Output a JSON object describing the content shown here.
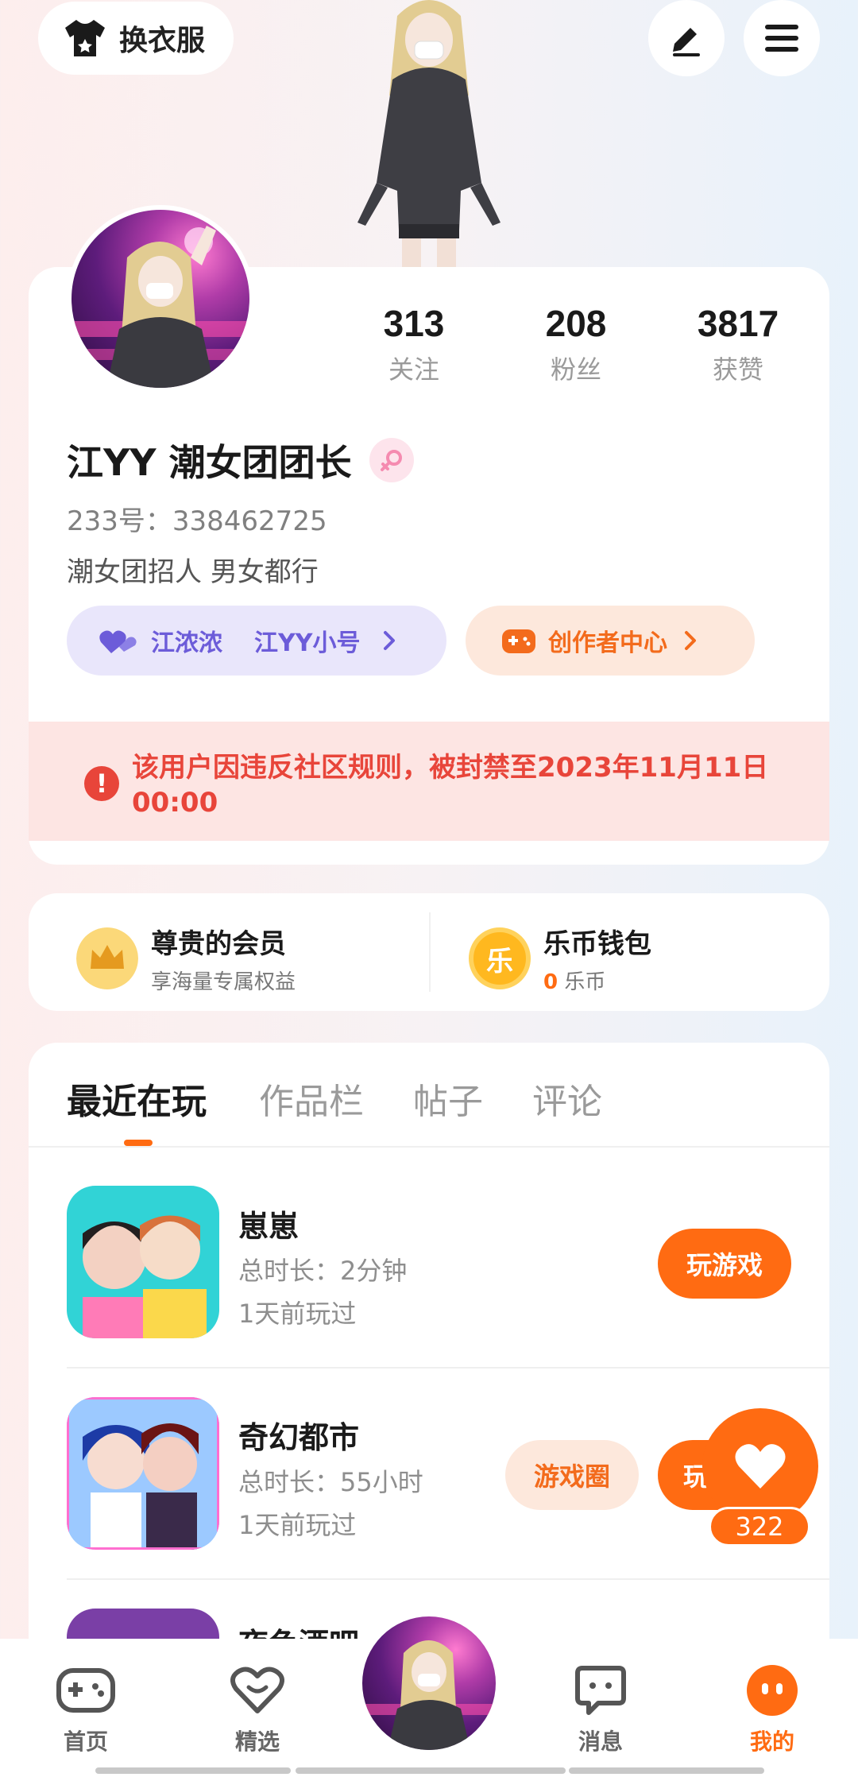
{
  "top_bar": {
    "outfit_label": "换衣服"
  },
  "profile": {
    "stats": [
      {
        "value": "313",
        "label": "关注"
      },
      {
        "value": "208",
        "label": "粉丝"
      },
      {
        "value": "3817",
        "label": "获赞"
      }
    ],
    "name": "江YY  潮女团团长",
    "uid": "233号：338462725",
    "bio": "潮女团招人 男女都行",
    "friend_pill": {
      "name1": "江浓浓",
      "name2": "江YY小号"
    },
    "creator_label": "创作者中心",
    "ban_notice": "该用户因违反社区规则，被封禁至2023年11月11日 00:00"
  },
  "membership": {
    "vip_title": "尊贵的会员",
    "vip_sub": "享海量专属权益",
    "wallet_title": "乐币钱包",
    "wallet_amount": "0",
    "wallet_unit": "乐币",
    "wallet_glyph": "乐"
  },
  "tabs": [
    "最近在玩",
    "作品栏",
    "帖子",
    "评论"
  ],
  "games": [
    {
      "name": "崽崽",
      "duration": "总时长：2分钟",
      "last": "1天前玩过",
      "play": "玩游戏"
    },
    {
      "name": "奇幻都市",
      "duration": "总时长：55小时",
      "last": "1天前玩过",
      "circle": "游戏圈",
      "play": "玩游戏"
    },
    {
      "name": "夜色酒吧"
    }
  ],
  "like_count": "322",
  "bottom_nav": {
    "home": "首页",
    "featured": "精选",
    "messages": "消息",
    "mine": "我的"
  },
  "colors": {
    "accent": "#ff6b12",
    "ban_red": "#e8453a",
    "friend_purple": "#6c5cd9"
  }
}
